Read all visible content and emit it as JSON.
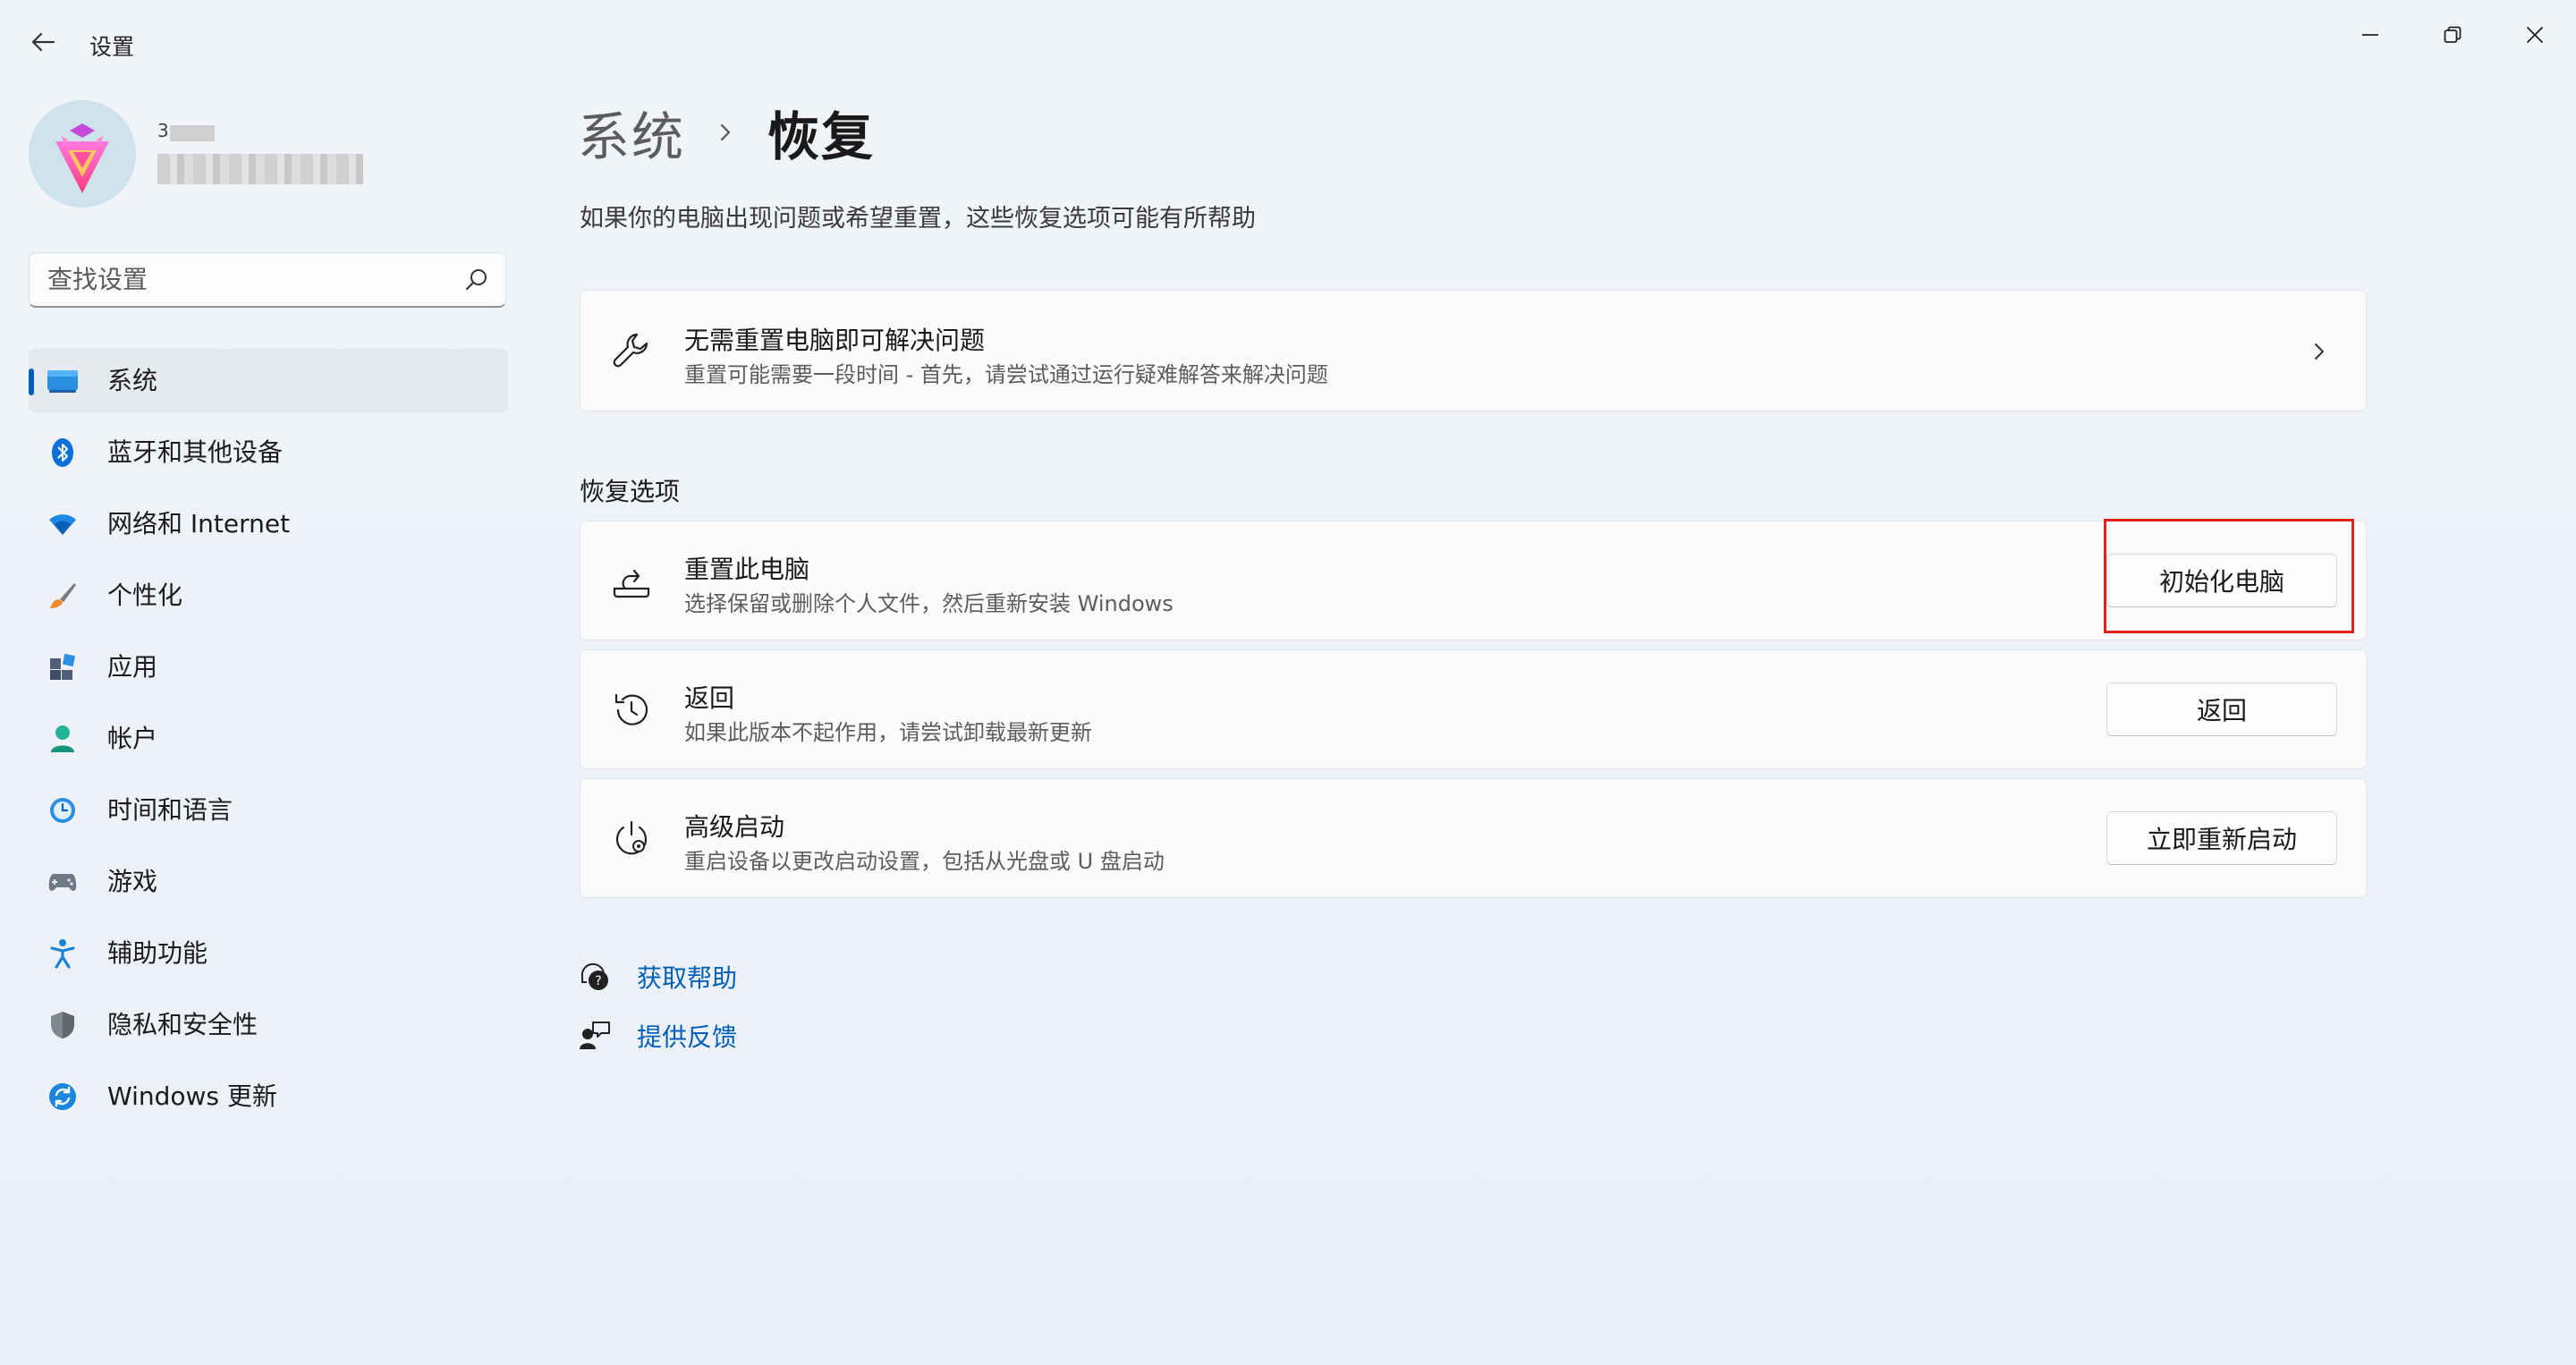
{
  "window": {
    "title": "设置",
    "minimize_icon": "minimize-icon",
    "maximize_icon": "restore-icon",
    "close_icon": "close-icon"
  },
  "sidebar": {
    "user_name_partial": "3",
    "search": {
      "placeholder": "查找设置",
      "value": ""
    },
    "items": [
      {
        "label": "系统",
        "icon": "system-monitor-icon",
        "selected": true
      },
      {
        "label": "蓝牙和其他设备",
        "icon": "bluetooth-icon",
        "selected": false
      },
      {
        "label": "网络和 Internet",
        "icon": "wifi-icon",
        "selected": false
      },
      {
        "label": "个性化",
        "icon": "paintbrush-icon",
        "selected": false
      },
      {
        "label": "应用",
        "icon": "apps-icon",
        "selected": false
      },
      {
        "label": "帐户",
        "icon": "account-icon",
        "selected": false
      },
      {
        "label": "时间和语言",
        "icon": "time-language-icon",
        "selected": false
      },
      {
        "label": "游戏",
        "icon": "gamepad-icon",
        "selected": false
      },
      {
        "label": "辅助功能",
        "icon": "accessibility-icon",
        "selected": false
      },
      {
        "label": "隐私和安全性",
        "icon": "shield-icon",
        "selected": false
      },
      {
        "label": "Windows 更新",
        "icon": "windows-update-icon",
        "selected": false
      }
    ]
  },
  "main": {
    "breadcrumb": {
      "parent": "系统",
      "current": "恢复"
    },
    "subtitle": "如果你的电脑出现问题或希望重置，这些恢复选项可能有所帮助",
    "troubleshoot_card": {
      "title": "无需重置电脑即可解决问题",
      "description": "重置可能需要一段时间 - 首先，请尝试通过运行疑难解答来解决问题"
    },
    "section_label": "恢复选项",
    "options": [
      {
        "title": "重置此电脑",
        "description": "选择保留或删除个人文件，然后重新安装 Windows",
        "button": "初始化电脑",
        "icon": "reset-pc-icon"
      },
      {
        "title": "返回",
        "description": "如果此版本不起作用，请尝试卸载最新更新",
        "button": "返回",
        "icon": "history-icon"
      },
      {
        "title": "高级启动",
        "description": "重启设备以更改启动设置，包括从光盘或 U 盘启动",
        "button": "立即重新启动",
        "icon": "advanced-startup-icon"
      }
    ],
    "links": [
      {
        "label": "获取帮助",
        "icon": "get-help-icon"
      },
      {
        "label": "提供反馈",
        "icon": "feedback-icon"
      }
    ]
  },
  "colors": {
    "accent": "#005fb8",
    "highlight_box": "#e2231a",
    "background": "#eef2f8",
    "card": "#fbfbfc"
  }
}
